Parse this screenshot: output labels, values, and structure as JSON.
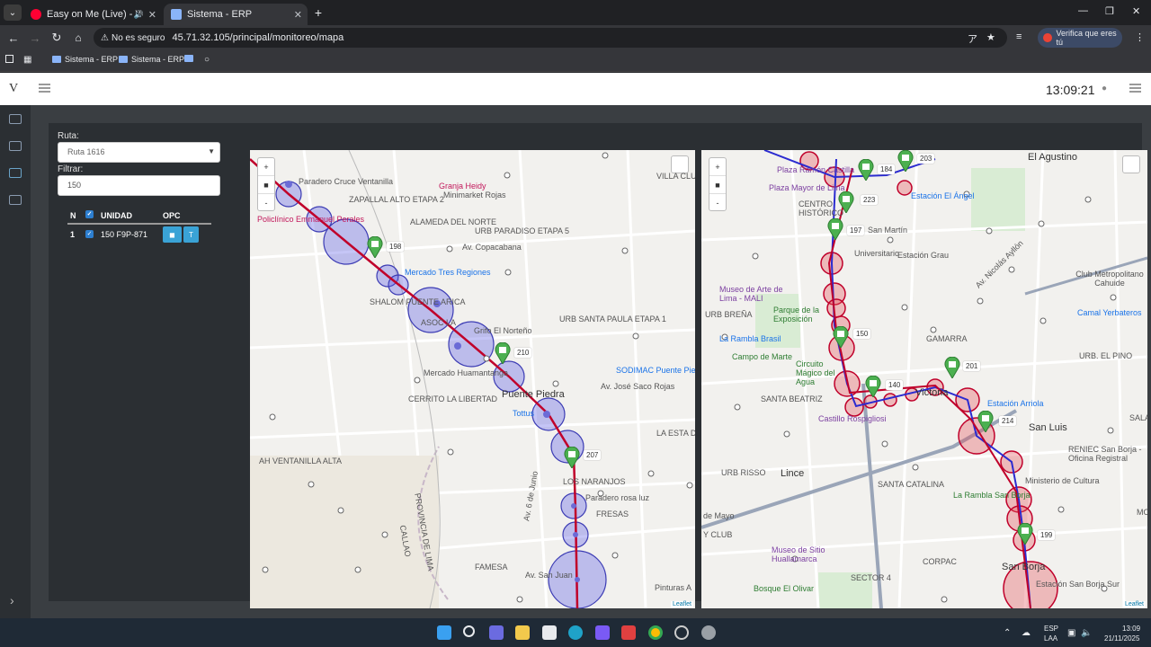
{
  "browser": {
    "tabs": [
      {
        "title": "Easy on Me (Live) - YouTube",
        "favicon_color": "#ff0033",
        "active": false
      },
      {
        "title": "Sistema - ERP",
        "favicon_color": "#8ab4f8",
        "active": true
      }
    ],
    "security_label": "No es seguro",
    "url": "45.71.32.105/principal/monitoreo/mapa",
    "verify_label": "Verifica que eres tú",
    "bookmarks": [
      "Sistema - ERP",
      "Sistema - ERP"
    ]
  },
  "app": {
    "logo": "V",
    "clock": "13:09:21"
  },
  "filters": {
    "ruta_label": "Ruta:",
    "ruta_value": "Ruta 1616",
    "filtrar_label": "Filtrar:",
    "filtrar_value": "150"
  },
  "units_table": {
    "headers": {
      "n": "N",
      "unidad": "UNIDAD",
      "opc": "OPC"
    },
    "rows": [
      {
        "n": "1",
        "unidad": "150 F9P-871",
        "btn_t": "T"
      }
    ]
  },
  "map_left": {
    "labels": [
      "Paradero Cruce Ventanilla",
      "ZAPALLAL ALTO ETAPA 2",
      "Granja Heidy",
      "Minimarket Rojas",
      "VILLA CLUB",
      "Policlínico Emmanuel Perales",
      "ALAMEDA DEL NORTE",
      "URB PARADISO ETAPA 5",
      "Av. Copacabana",
      "Mercado Tres Regiones",
      "SHALOM PUENTE ARICA",
      "ASOC LA",
      "Grifo El Norteño",
      "URB SANTA PAULA ETAPA 1",
      "Mercado Huamantanga",
      "SODIMAC Puente Pied",
      "CERRITO LA LIBERTAD",
      "Av. José Saco Rojas",
      "Puente Piedra",
      "Tottus",
      "LA ESTA DE CARAB",
      "AH VENTANILLA ALTA",
      "Av. 6 de Junio",
      "LOS NARANJOS",
      "Paradero rosa luz",
      "FRESAS",
      "PROVINCIA DE LIMA",
      "CALLAO",
      "FAMESA",
      "Av. San Juan",
      "Pinturas A"
    ],
    "bus_numbers": [
      "198",
      "210",
      "207"
    ],
    "attribution": "Leaflet"
  },
  "map_right": {
    "labels": [
      "Plaza Ramón Castilla",
      "Plaza Mayor de Lima",
      "El Agustino",
      "Estación El Ángel",
      "CENTRO HISTÓRICO",
      "San Martín",
      "Universitario",
      "Estación Grau",
      "Av. Nicolás Ayllón",
      "Club Metropolitano Cahuide",
      "Museo de Arte de Lima - MALI",
      "URB BREÑA",
      "Parque de la Exposición",
      "Camal Yerbateros",
      "La Rambla Brasil",
      "GAMARRA",
      "Campo de Marte",
      "Circuito Mágico del Agua",
      "URB. EL PINO",
      "SANTA BEATRIZ",
      "Victoria",
      "Castillo Rospigliosi",
      "Estación Arriola",
      "San Luis",
      "SALA",
      "URB RISSO",
      "Lince",
      "SANTA CATALINA",
      "RENIEC San Borja - Oficina Registral",
      "Ministerio de Cultura",
      "La Rambla San Borja",
      "de Mayo",
      "Y CLUB",
      "Museo de Sitio Huallamarca",
      "CORPAC",
      "San Borja",
      "Bosque El Olivar",
      "SECTOR 4",
      "Estación San Borja Sur",
      "MO"
    ],
    "bus_numbers": [
      "184",
      "203",
      "223",
      "197",
      "150",
      "201",
      "140",
      "214",
      "199"
    ],
    "attribution": "Leaflet"
  },
  "taskbar": {
    "lang": "ESP",
    "layout": "LAA",
    "time": "13:09",
    "date": "21/11/2025"
  }
}
